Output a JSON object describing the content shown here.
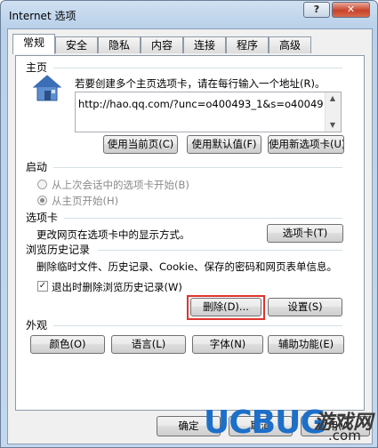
{
  "window": {
    "title": "Internet 选项",
    "help_label": "?",
    "close_label": "✕"
  },
  "tabs": [
    "常规",
    "安全",
    "隐私",
    "内容",
    "连接",
    "程序",
    "高级"
  ],
  "home": {
    "section_label": "主页",
    "instruction": "若要创建多个主页选项卡，请在每行输入一个地址(R)。",
    "url_value": "http://hao.qq.com/?unc=o400493_1&s=o40049",
    "buttons": [
      "使用当前页(C)",
      "使用默认值(F)",
      "使用新选项卡(U)"
    ]
  },
  "startup": {
    "section_label": "启动",
    "option1": "从上次会话中的选项卡开始(B)",
    "option2": "从主页开始(H)"
  },
  "tabs_section": {
    "section_label": "选项卡",
    "description": "更改网页在选项卡中的显示方式。",
    "button": "选项卡(T)"
  },
  "history": {
    "section_label": "浏览历史记录",
    "description": "删除临时文件、历史记录、Cookie、保存的密码和网页表单信息。",
    "checkbox_label": "退出时删除浏览历史记录(W)",
    "delete_button": "删除(D)...",
    "settings_button": "设置(S)"
  },
  "appearance": {
    "section_label": "外观",
    "buttons": [
      "颜色(O)",
      "语言(L)",
      "字体(N)",
      "辅助功能(E)"
    ]
  },
  "footer": {
    "ok": "确定",
    "cancel": "取消",
    "apply": "应用(A)"
  },
  "watermark": {
    "brand": "UCBUG",
    "site": "游戏网",
    "domain": ".com"
  },
  "colors": {
    "accent": "#e0332d",
    "brand_blue": "#1d6fc8",
    "brand_green": "#5cb82e"
  }
}
